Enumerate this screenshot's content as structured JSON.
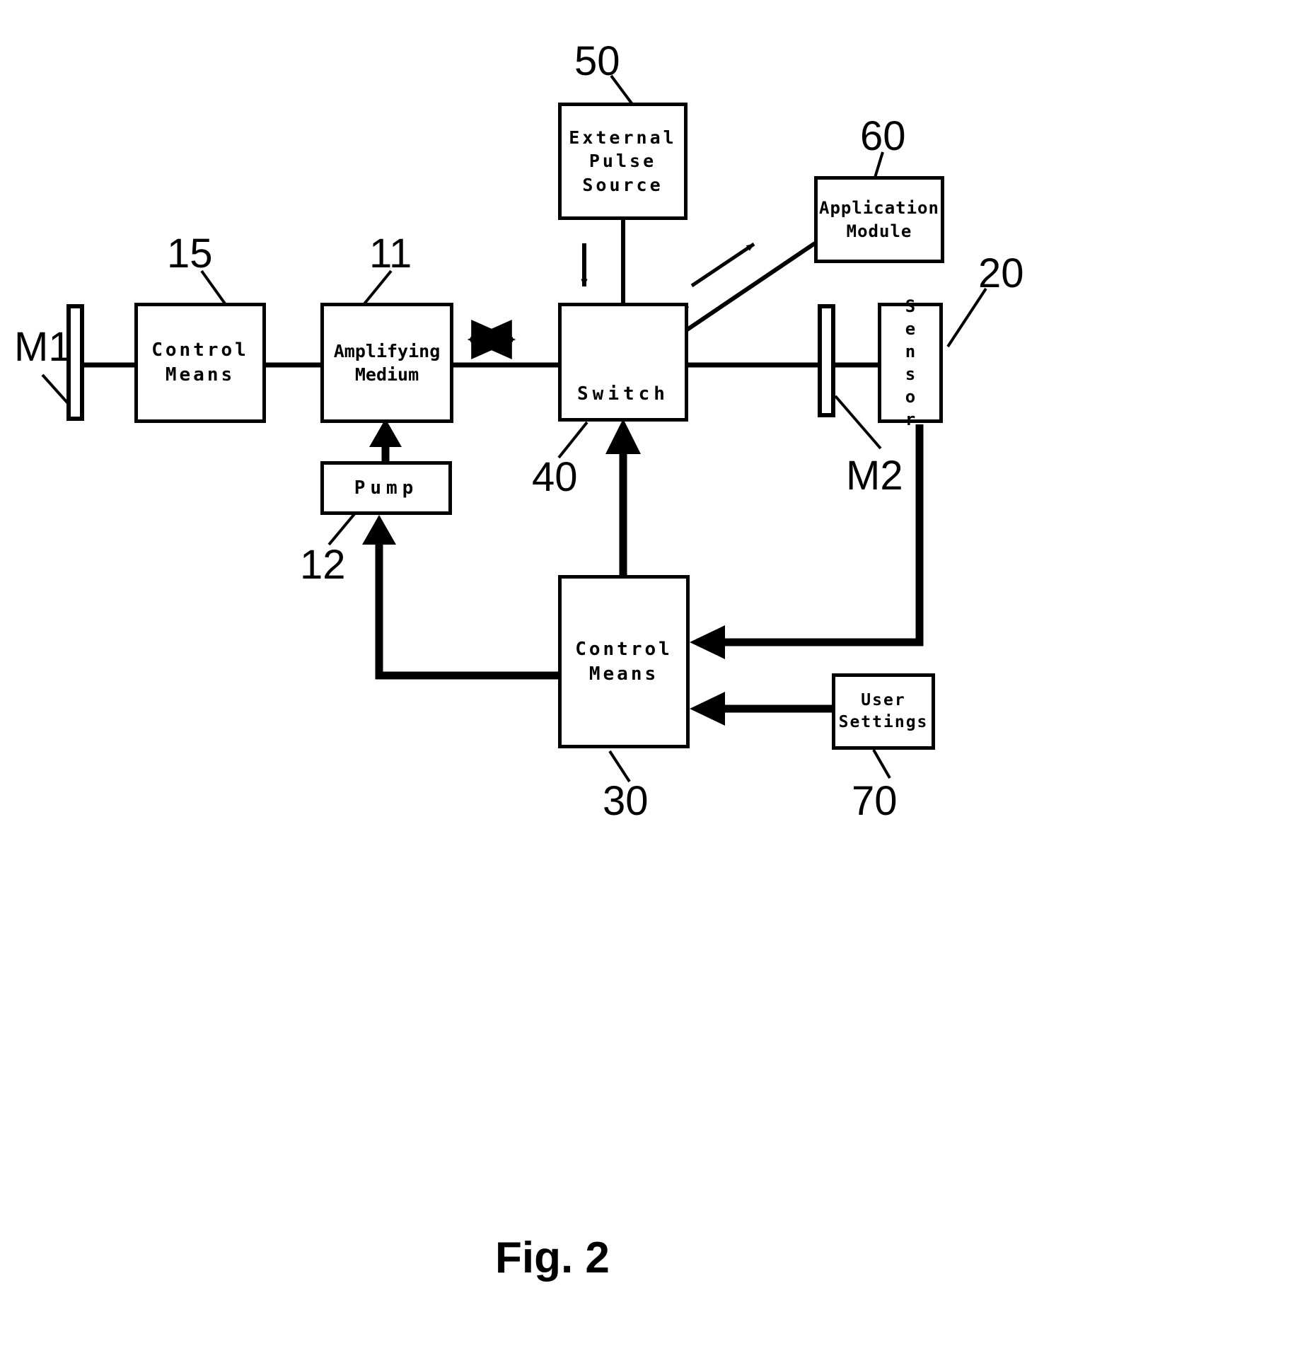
{
  "figure": {
    "caption": "Fig. 2",
    "title_number": "2"
  },
  "nodes": {
    "control_means_15": {
      "lines": [
        "Control",
        "Means"
      ],
      "ref": "15"
    },
    "amplifying_medium_11": {
      "lines": [
        "Amplifying",
        "Medium"
      ],
      "ref": "11"
    },
    "pump_12": {
      "lines": [
        "Pump"
      ],
      "ref": "12"
    },
    "switch_40": {
      "lines": [
        "Switch"
      ],
      "ref": "40"
    },
    "external_pulse_source_50": {
      "lines": [
        "External",
        "Pulse",
        "Source"
      ],
      "ref": "50"
    },
    "application_module_60": {
      "lines": [
        "Application",
        "Module"
      ],
      "ref": "60"
    },
    "sensor_20": {
      "lines": [
        "S",
        "e",
        "n",
        "s",
        "o",
        "r"
      ],
      "label": "Sensor",
      "ref": "20"
    },
    "control_means_30": {
      "lines": [
        "Control",
        "Means"
      ],
      "ref": "30"
    },
    "user_settings_70": {
      "lines": [
        "User",
        "Settings"
      ],
      "ref": "70"
    },
    "mirror_m1": {
      "label": "M1"
    },
    "mirror_m2": {
      "label": "M2"
    }
  },
  "colors": {
    "stroke": "#000000",
    "background": "#ffffff"
  },
  "connections": [
    {
      "name": "m1-to-control-means-15",
      "type": "line"
    },
    {
      "name": "control-means-15-to-amplifying-medium",
      "type": "line"
    },
    {
      "name": "amplifying-medium-to-switch",
      "type": "line"
    },
    {
      "name": "cavity-bidirectional-arrow",
      "type": "double-arrow"
    },
    {
      "name": "pump-to-amplifying-medium",
      "type": "arrow"
    },
    {
      "name": "control-means-30-to-pump",
      "type": "arrow"
    },
    {
      "name": "control-means-30-to-switch",
      "type": "arrow"
    },
    {
      "name": "external-pulse-source-to-switch",
      "type": "line"
    },
    {
      "name": "external-pulse-injection-arrow",
      "type": "arrow"
    },
    {
      "name": "switch-to-application-module",
      "type": "arrow"
    },
    {
      "name": "switch-to-m2",
      "type": "line"
    },
    {
      "name": "m2-to-sensor",
      "type": "line"
    },
    {
      "name": "sensor-to-control-means-30",
      "type": "arrow"
    },
    {
      "name": "user-settings-to-control-means-30",
      "type": "arrow"
    }
  ]
}
